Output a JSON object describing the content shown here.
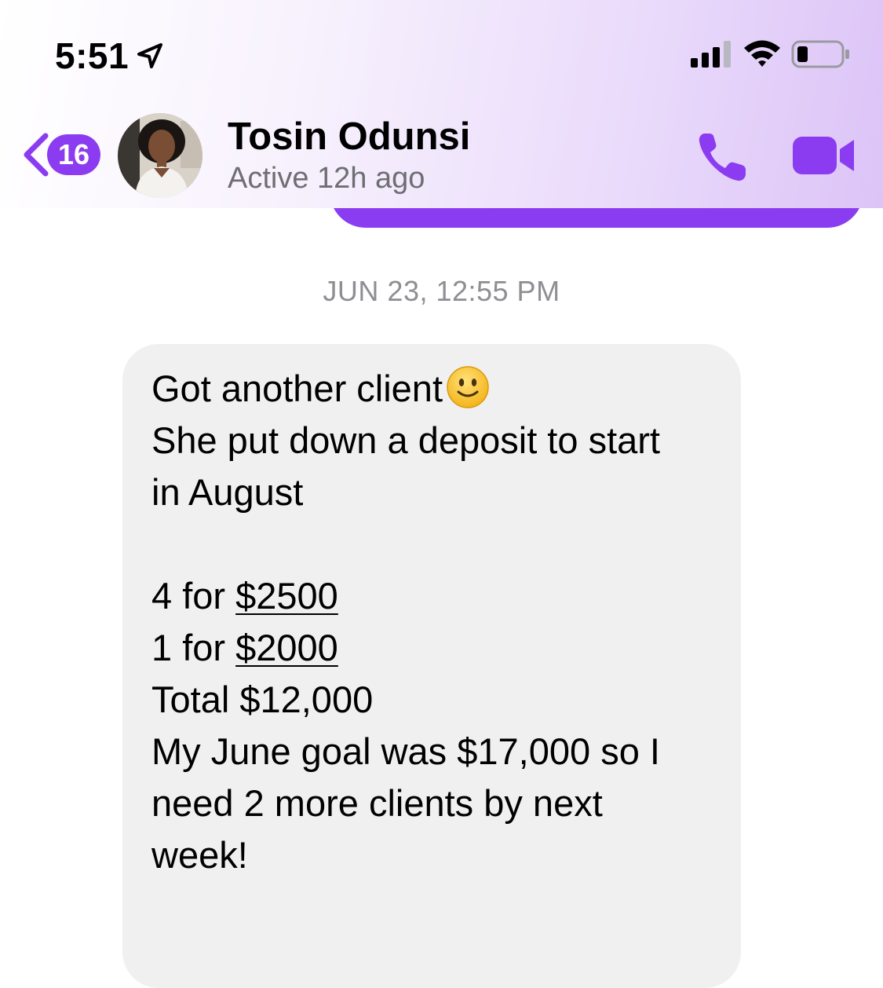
{
  "status_bar": {
    "time": "5:51"
  },
  "header": {
    "unread_count": "16",
    "contact_name": "Tosin Odunsi",
    "contact_status": "Active 12h ago"
  },
  "conversation": {
    "timestamp": "JUN 23, 12:55 PM",
    "message": {
      "line1": "Got another client",
      "line2": "She put down a deposit to start",
      "line3": "in August",
      "line4_prefix": "4 for ",
      "line4_amount": "$2500",
      "line5_prefix": "1 for ",
      "line5_amount": "$2000",
      "line6": "Total $12,000",
      "line7": "My June goal was $17,000 so I",
      "line8": "need 2 more clients by next",
      "line9": "week!"
    }
  },
  "colors": {
    "accent": "#8b3cf0",
    "bubble_gray": "#f0f0f0",
    "secondary_text": "#8e8e93"
  }
}
